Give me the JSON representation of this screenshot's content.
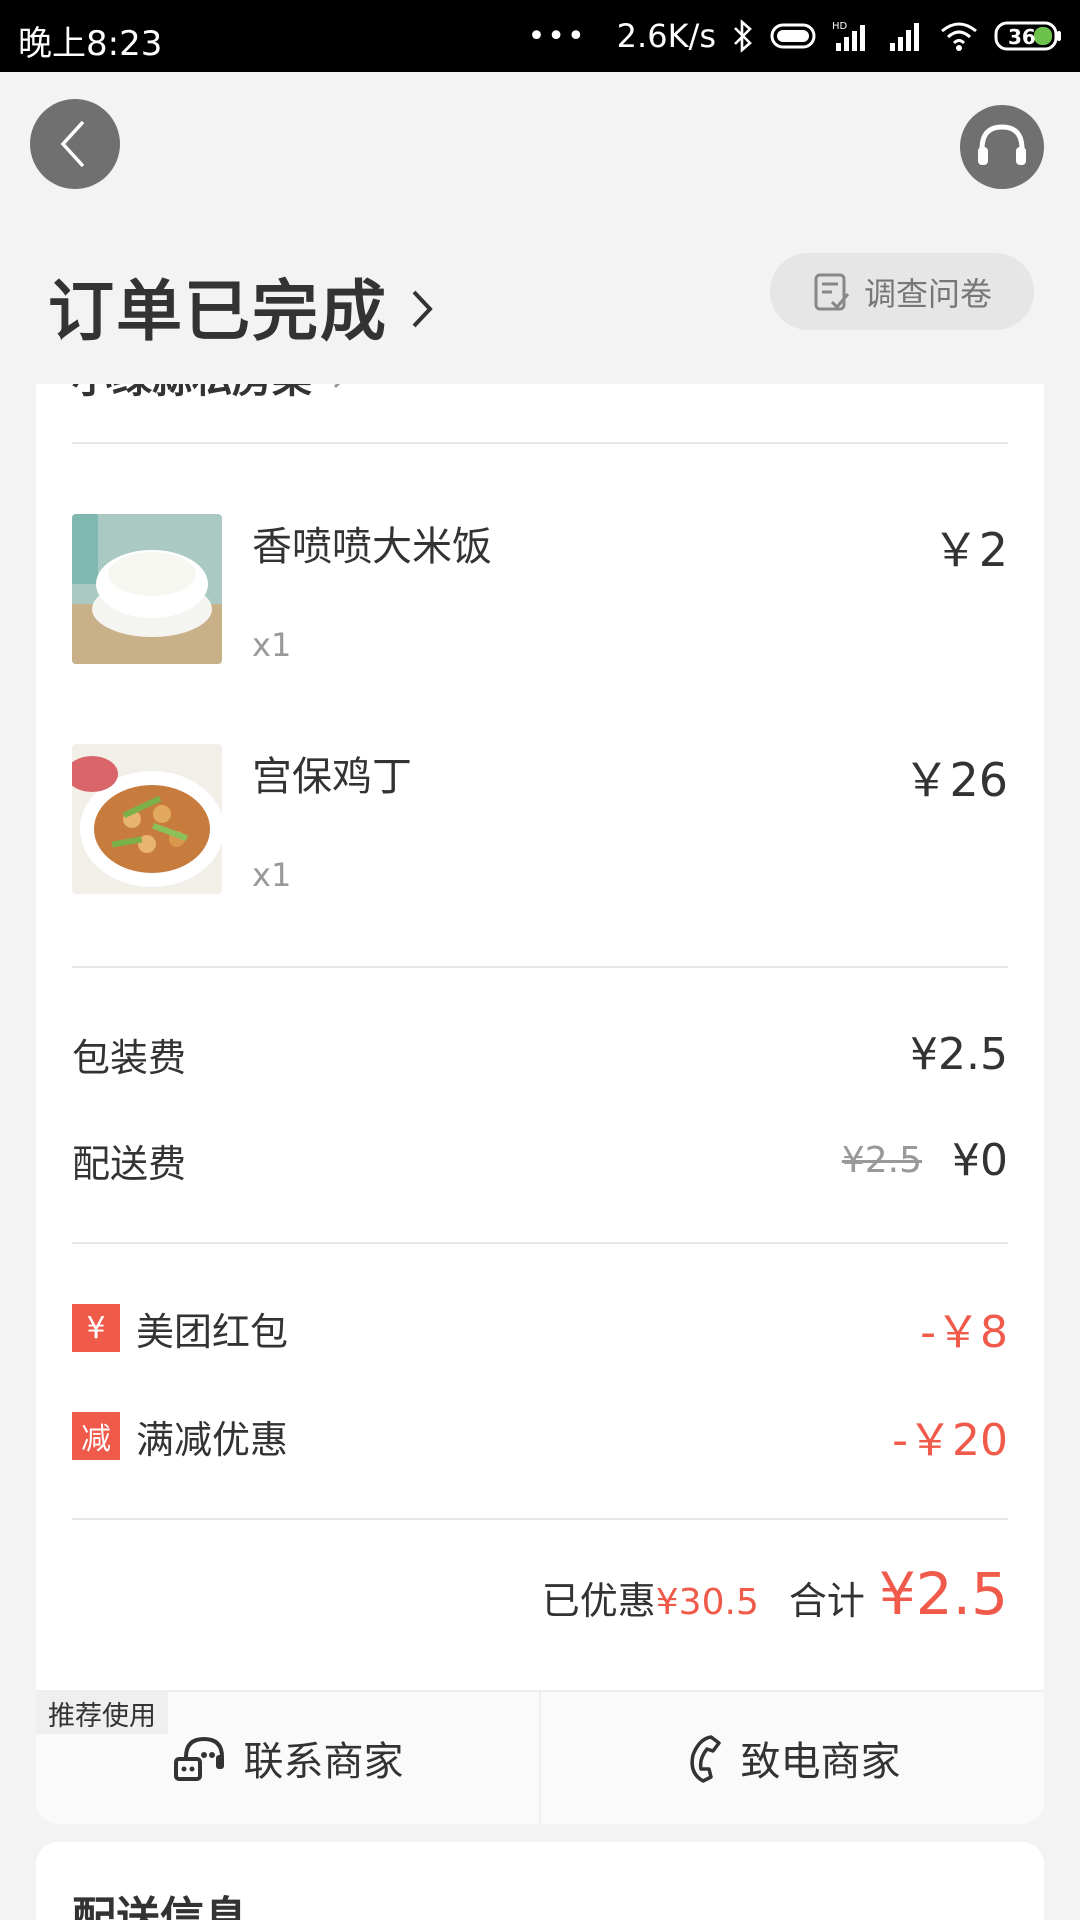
{
  "status_bar": {
    "time": "晚上8:23",
    "dots": "•••",
    "speed": "2.6K/s",
    "battery": "36"
  },
  "header": {
    "title": "订单已完成",
    "survey_label": "调查问卷"
  },
  "merchant": {
    "name": "小绿蒜私房菜"
  },
  "items": [
    {
      "name": "香喷喷大米饭",
      "qty": "x1",
      "price": "￥2"
    },
    {
      "name": "宫保鸡丁",
      "qty": "x1",
      "price": "￥26"
    }
  ],
  "fees": {
    "packing_label": "包装费",
    "packing_value": "¥2.5",
    "delivery_label": "配送费",
    "delivery_original": "¥2.5",
    "delivery_value": "¥0"
  },
  "discounts": [
    {
      "tag": "¥",
      "label": "美团红包",
      "value": "-￥8"
    },
    {
      "tag": "减",
      "label": "满减优惠",
      "value": "-￥20"
    }
  ],
  "totals": {
    "saved_label": "已优惠",
    "saved_value": "¥30.5",
    "total_label": "合计",
    "total_value": "¥2.5"
  },
  "actions": {
    "recommend_badge": "推荐使用",
    "contact_label": "联系商家",
    "call_label": "致电商家"
  },
  "delivery_section": {
    "title": "配送信息"
  },
  "colors": {
    "accent_red": "#f05a4a",
    "text_dark": "#333333",
    "text_grey": "#999999"
  }
}
